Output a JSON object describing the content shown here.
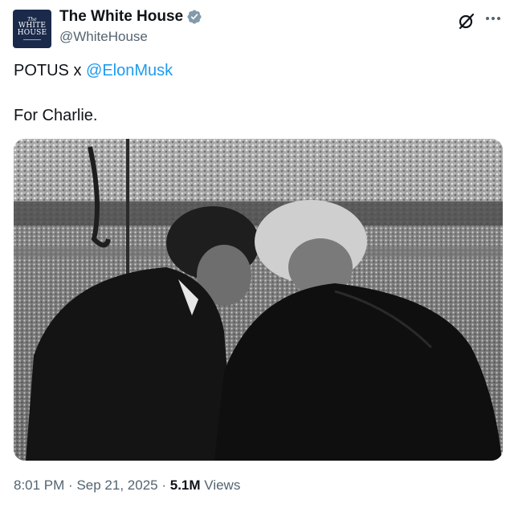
{
  "account": {
    "display_name": "The White House",
    "handle": "@WhiteHouse",
    "verified": true,
    "verified_color": "#829aab",
    "avatar": {
      "line1": "The",
      "line2": "WHITE",
      "line3": "HOUSE"
    }
  },
  "tweet": {
    "prefix": "POTUS x ",
    "mention": "@ElonMusk",
    "line2": "For Charlie.",
    "mention_color": "#1d9bf0"
  },
  "media": {
    "style": "black-and-white photo"
  },
  "meta": {
    "time": "8:01 PM",
    "separator": "·",
    "date": "Sep 21, 2025",
    "views_count": "5.1M",
    "views_label": "Views"
  },
  "icons": {
    "grok": "grok-icon",
    "more": "more-icon",
    "verified": "verified-badge-icon"
  }
}
